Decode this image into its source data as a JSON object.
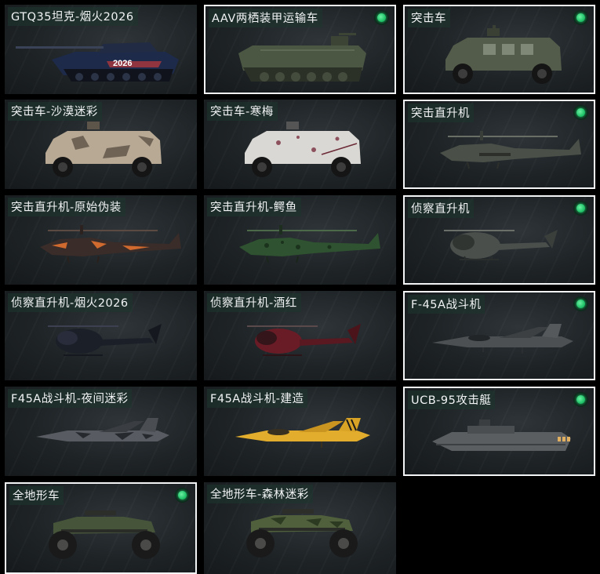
{
  "vehicles": [
    {
      "name": "GTQ35坦克-烟火2026",
      "owned": false,
      "selected": false,
      "icon": "tank-icon",
      "decal": "2026"
    },
    {
      "name": "AAV两栖装甲运输车",
      "owned": true,
      "selected": true,
      "icon": "amphibious-vehicle-icon"
    },
    {
      "name": "突击车",
      "owned": true,
      "selected": true,
      "icon": "assault-car-icon"
    },
    {
      "name": "突击车-沙漠迷彩",
      "owned": false,
      "selected": false,
      "icon": "assault-car-desert-icon"
    },
    {
      "name": "突击车-寒梅",
      "owned": false,
      "selected": false,
      "icon": "assault-car-plum-icon"
    },
    {
      "name": "突击直升机",
      "owned": true,
      "selected": true,
      "icon": "attack-helicopter-icon"
    },
    {
      "name": "突击直升机-原始伪装",
      "owned": false,
      "selected": false,
      "icon": "attack-helicopter-primal-icon"
    },
    {
      "name": "突击直升机-鳄鱼",
      "owned": false,
      "selected": false,
      "icon": "attack-helicopter-croc-icon"
    },
    {
      "name": "侦察直升机",
      "owned": true,
      "selected": true,
      "icon": "scout-helicopter-icon"
    },
    {
      "name": "侦察直升机-烟火2026",
      "owned": false,
      "selected": false,
      "icon": "scout-helicopter-fireworks-icon"
    },
    {
      "name": "侦察直升机-酒红",
      "owned": false,
      "selected": false,
      "icon": "scout-helicopter-wine-icon"
    },
    {
      "name": "F-45A战斗机",
      "owned": true,
      "selected": true,
      "icon": "fighter-jet-icon"
    },
    {
      "name": "F45A战斗机-夜间迷彩",
      "owned": false,
      "selected": false,
      "icon": "fighter-jet-night-icon"
    },
    {
      "name": "F45A战斗机-建造",
      "owned": false,
      "selected": false,
      "icon": "fighter-jet-build-icon"
    },
    {
      "name": "UCB-95攻击艇",
      "owned": true,
      "selected": true,
      "icon": "attack-boat-icon"
    },
    {
      "name": "全地形车",
      "owned": true,
      "selected": true,
      "icon": "atv-icon"
    },
    {
      "name": "全地形车-森林迷彩",
      "owned": false,
      "selected": false,
      "icon": "atv-forest-icon"
    }
  ],
  "colors": {
    "owned_indicator": "#22c46a",
    "selected_border": "#f2f4f5",
    "card_bg": "#1e2326",
    "page_bg": "#000000"
  }
}
